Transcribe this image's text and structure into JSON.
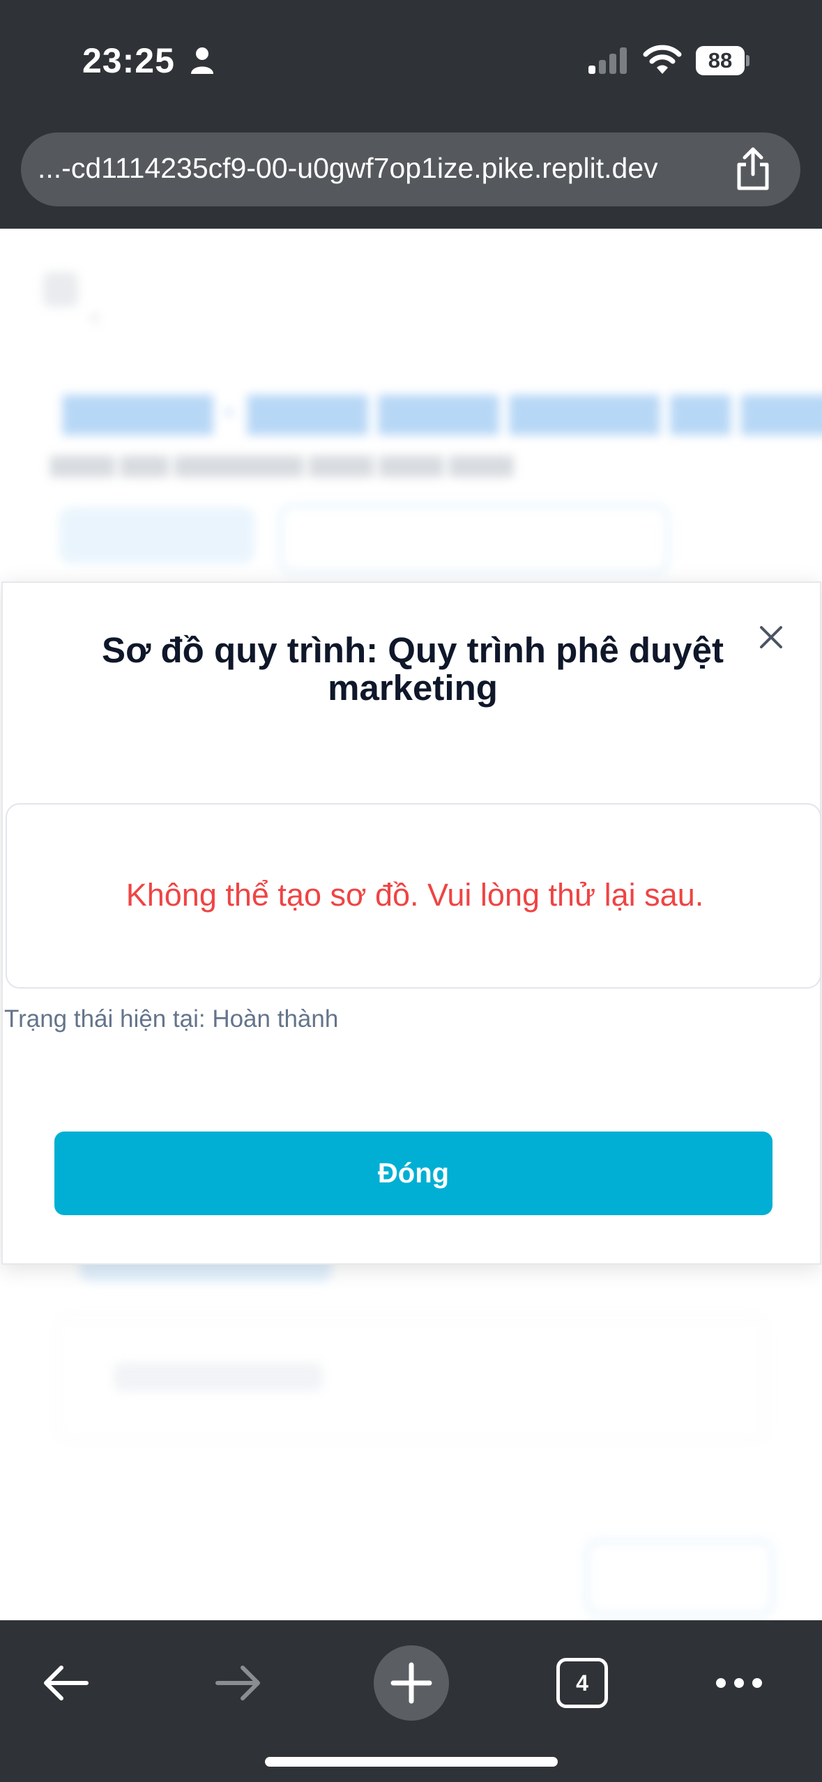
{
  "status_bar": {
    "time": "23:25",
    "battery": "88"
  },
  "browser": {
    "url": "...-cd1114235cf9-00-u0gwf7op1ize.pike.replit.dev",
    "tab_count": "4"
  },
  "modal": {
    "title": "Sơ đồ quy trình: Quy trình phê duyệt marketing",
    "error_message": "Không thể tạo sơ đồ. Vui lòng thử lại sau.",
    "status_text": "Trạng thái hiện tại: Hoàn thành",
    "close_button_label": "Đóng"
  },
  "colors": {
    "accent": "#00afd3",
    "error": "#ef4444",
    "chrome": "#2f3337"
  }
}
